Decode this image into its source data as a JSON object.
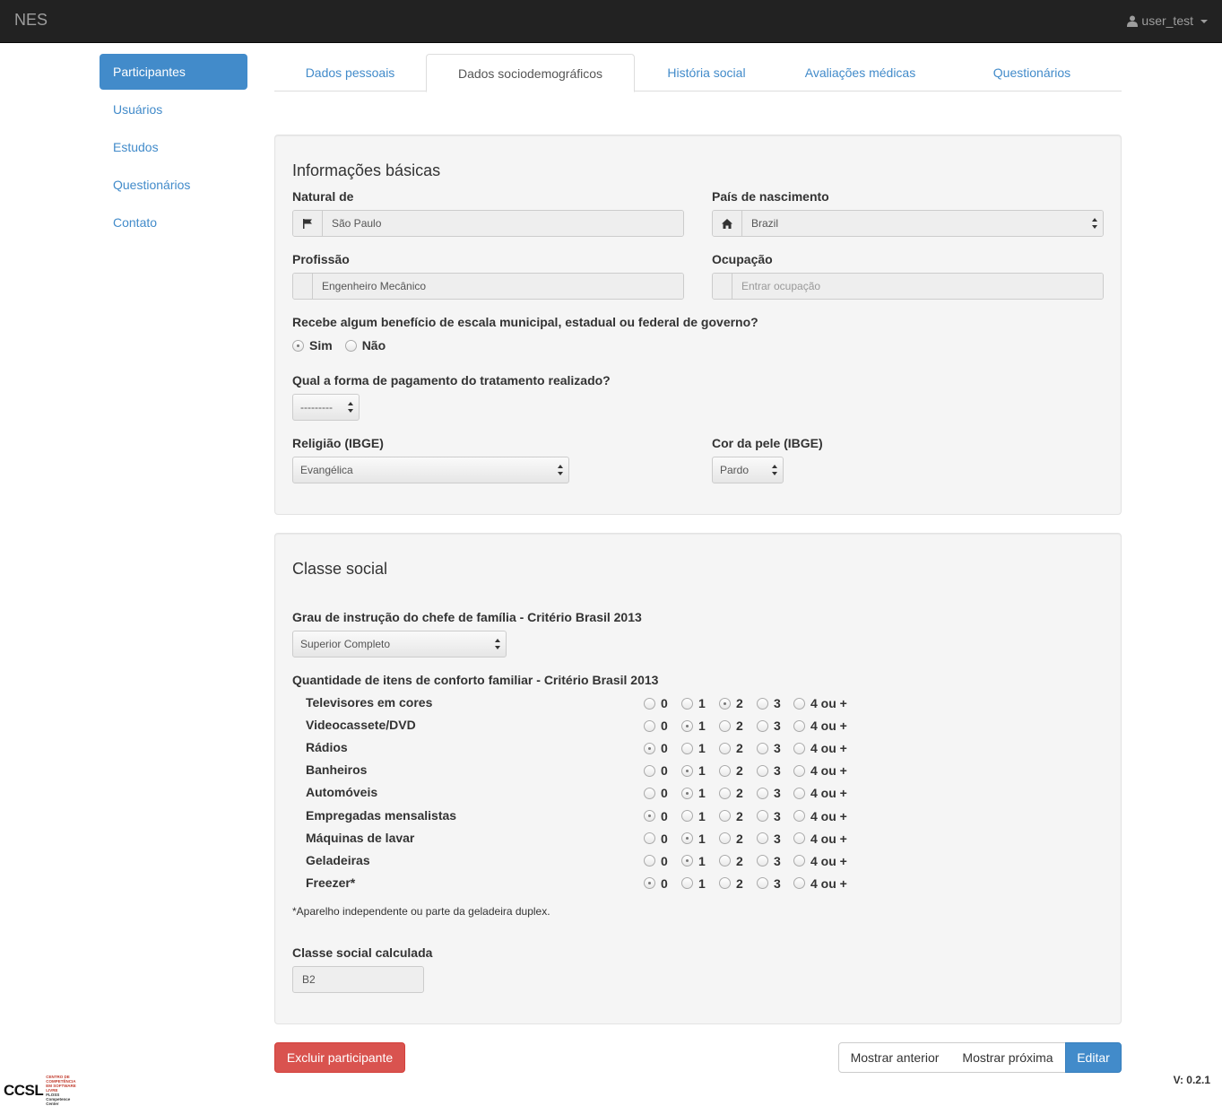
{
  "navbar": {
    "brand": "NES",
    "user": "user_test"
  },
  "sidebar": {
    "items": [
      {
        "label": "Participantes",
        "active": true
      },
      {
        "label": "Usuários",
        "active": false
      },
      {
        "label": "Estudos",
        "active": false
      },
      {
        "label": "Questionários",
        "active": false
      },
      {
        "label": "Contato",
        "active": false
      }
    ]
  },
  "tabs": [
    {
      "label": "Dados pessoais",
      "active": false
    },
    {
      "label": "Dados sociodemográficos",
      "active": true
    },
    {
      "label": "História social",
      "active": false
    },
    {
      "label": "Avaliações médicas",
      "active": false
    },
    {
      "label": "Questionários",
      "active": false
    }
  ],
  "basic_info": {
    "title": "Informações básicas",
    "natural_de_label": "Natural de",
    "natural_de_value": "São Paulo",
    "pais_label": "País de nascimento",
    "pais_value": "Brazil",
    "profissao_label": "Profissão",
    "profissao_value": "Engenheiro Mecânico",
    "ocupacao_label": "Ocupação",
    "ocupacao_placeholder": "Entrar ocupação",
    "beneficio_label": "Recebe algum benefício de escala municipal, estadual ou federal de governo?",
    "beneficio_sim": "Sim",
    "beneficio_nao": "Não",
    "beneficio_selected": "Sim",
    "pagamento_label": "Qual a forma de pagamento do tratamento realizado?",
    "pagamento_value": "---------",
    "religiao_label": "Religião (IBGE)",
    "religiao_value": "Evangélica",
    "cor_label": "Cor da pele (IBGE)",
    "cor_value": "Pardo"
  },
  "social_class": {
    "title": "Classe social",
    "grau_label": "Grau de instrução do chefe de família - Critério Brasil 2013",
    "grau_value": "Superior Completo",
    "itens_label": "Quantidade de itens de conforto familiar - Critério Brasil 2013",
    "options": [
      "0",
      "1",
      "2",
      "3",
      "4 ou +"
    ],
    "items": [
      {
        "label": "Televisores em cores",
        "selected": 2
      },
      {
        "label": "Videocassete/DVD",
        "selected": 1
      },
      {
        "label": "Rádios",
        "selected": 0
      },
      {
        "label": "Banheiros",
        "selected": 1
      },
      {
        "label": "Automóveis",
        "selected": 1
      },
      {
        "label": "Empregadas mensalistas",
        "selected": 0
      },
      {
        "label": "Máquinas de lavar",
        "selected": 1
      },
      {
        "label": "Geladeiras",
        "selected": 1
      },
      {
        "label": "Freezer*",
        "selected": 0
      }
    ],
    "note": "*Aparelho independente ou parte da geladeira duplex.",
    "classe_label": "Classe social calculada",
    "classe_value": "B2"
  },
  "actions": {
    "delete": "Excluir participante",
    "previous": "Mostrar anterior",
    "next": "Mostrar próxima",
    "edit": "Editar"
  },
  "footer": {
    "logo": "CCSL",
    "logo_subtitle": "CENTRO DE COMPETÊNCIA EM SOFTWARE LIVRE",
    "logo_tagline": "FLOSS Competence Center",
    "version": "V: 0.2.1"
  },
  "colors": {
    "primary": "#428bca",
    "danger": "#d9534f",
    "navbar": "#222222"
  },
  "icons": {
    "natural_de": "flag-icon",
    "pais": "home-icon",
    "user": "user-icon"
  }
}
